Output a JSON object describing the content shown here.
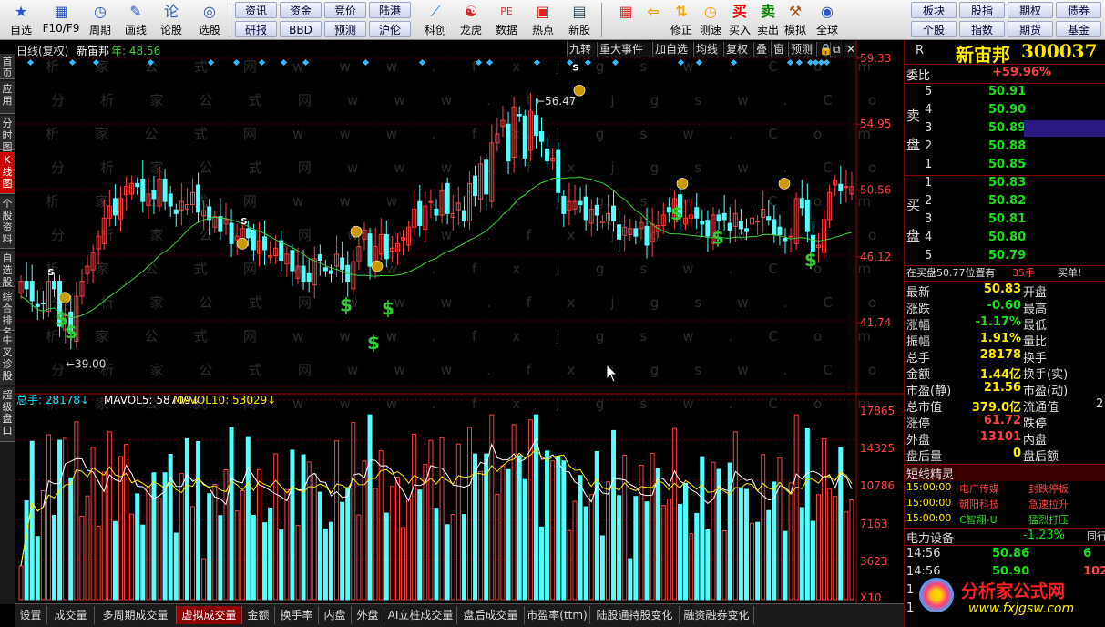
{
  "toolbar": {
    "items": [
      {
        "label": "自选",
        "icon": "star-icon"
      },
      {
        "label": "F10/F9",
        "icon": "grid-icon"
      },
      {
        "label": "周期",
        "icon": "clock-icon"
      },
      {
        "label": "画线",
        "icon": "pencil-icon"
      },
      {
        "label": "论股",
        "icon": "discuss-icon"
      },
      {
        "label": "选股",
        "icon": "chart-icon"
      }
    ],
    "buttons": [
      "资讯",
      "资金",
      "竞价",
      "陆港",
      "研报",
      "BBD",
      "预测",
      "沪伦"
    ],
    "items2": [
      {
        "label": "科创",
        "icon": "kechuang-icon"
      },
      {
        "label": "龙虎",
        "icon": "dragon-icon"
      },
      {
        "label": "数据",
        "icon": "pe-icon"
      },
      {
        "label": "热点",
        "icon": "hot-icon"
      },
      {
        "label": "新股",
        "icon": "doc-icon"
      }
    ],
    "items3": [
      {
        "label": "",
        "icon": "windows-icon"
      },
      {
        "label": "",
        "icon": "back-icon"
      },
      {
        "label": "修正",
        "icon": "fix-icon"
      },
      {
        "label": "测速",
        "icon": "speed-icon"
      },
      {
        "label": "买入",
        "icon": "buy-icon",
        "glyph": "买"
      },
      {
        "label": "卖出",
        "icon": "sell-icon",
        "glyph": "卖"
      },
      {
        "label": "模拟",
        "icon": "hammer-icon"
      },
      {
        "label": "全球",
        "icon": "globe-icon"
      }
    ],
    "buttons2": [
      "板块",
      "股指",
      "期权",
      "债券",
      "个股",
      "指数",
      "期货",
      "基金"
    ]
  },
  "lefttabs": [
    "首页",
    "应用",
    "分时图",
    "K线图",
    "个股资料",
    "自选股",
    "综合排名",
    "牛叉诊股",
    "超级盘口"
  ],
  "chart": {
    "title": "日线(复权)",
    "name": "新宙邦",
    "ma_label": "年: 48.56",
    "buttons": [
      "九转",
      "重大事件",
      "加自选",
      "均线",
      "复权",
      "叠",
      "窗",
      "预测",
      "🔒",
      "⧉",
      "✕"
    ],
    "price_ticks": [
      "59.33",
      "54.95",
      "50.56",
      "46.12",
      "41.74"
    ],
    "high_label": "56.47",
    "low_label": "39.00",
    "vol_legend": {
      "a": "总手: 28178↓",
      "b": "MAVOL5: 58709↓",
      "c": "MAVOL10: 53029↓"
    },
    "vol_ticks": [
      "17865",
      "14325",
      "10786",
      "7163",
      "3623",
      "X10"
    ],
    "watermark": "分析家公式网www.fxjgsw.Com"
  },
  "bottomtabs": [
    "设置",
    "成交量",
    "多周期成交量",
    "虚拟成交量",
    "金额",
    "换手率",
    "内盘",
    "外盘",
    "AI立桩成交量",
    "盘后成交量",
    "市盈率(ttm)",
    "陆股通持股变化",
    "融资融券变化"
  ],
  "bottom_active": 3,
  "panel": {
    "flag": "R",
    "name": "新宙邦",
    "code": "300037",
    "wb_label": "委比",
    "wb_value": "+59.96%",
    "sell": [
      [
        "5",
        "50.91"
      ],
      [
        "4",
        "50.90"
      ],
      [
        "3",
        "50.89"
      ],
      [
        "2",
        "50.88"
      ],
      [
        "1",
        "50.85"
      ]
    ],
    "buy": [
      [
        "1",
        "50.83"
      ],
      [
        "2",
        "50.82"
      ],
      [
        "3",
        "50.81"
      ],
      [
        "4",
        "50.80"
      ],
      [
        "5",
        "50.79"
      ]
    ],
    "sell_label": [
      "卖",
      "盘"
    ],
    "buy_label": [
      "买",
      "盘"
    ],
    "order_info": "在买盘50.77位置有",
    "order_count": "35手",
    "order_action": "买单!",
    "stats": [
      [
        "最新",
        "50.83",
        "开盘"
      ],
      [
        "涨跌",
        "-0.60",
        "最高"
      ],
      [
        "涨幅",
        "-1.17%",
        "最低"
      ],
      [
        "振幅",
        "1.91%",
        "量比"
      ],
      [
        "总手",
        "28178",
        "换手"
      ],
      [
        "金额",
        "1.44亿",
        "换手(实)"
      ],
      [
        "市盈(静)",
        "21.56",
        "市盈(动)"
      ],
      [
        "总市值",
        "379.0亿",
        "流通值"
      ],
      [
        "涨停",
        "61.72",
        "跌停"
      ],
      [
        "外盘",
        "13101",
        "内盘"
      ],
      [
        "盘后量",
        "0",
        "盘后额"
      ]
    ],
    "stats_extra": "2",
    "short_title": "短线精灵",
    "short": [
      [
        "15:00:00",
        "电广传媒",
        "封跌停板"
      ],
      [
        "15:00:00",
        "朝阳科技",
        "急速拉升"
      ],
      [
        "15:00:00",
        "C智翔-U",
        "猛烈打压"
      ]
    ],
    "sector": "电力设备",
    "sector_pct": "-1.23%",
    "sector_tag": "同行",
    "ticks": [
      [
        "14:56",
        "50.86",
        "6"
      ],
      [
        "14:56",
        "50.90",
        "102"
      ],
      [
        "1",
        "",
        ""
      ],
      [
        "1",
        "",
        ""
      ]
    ],
    "logo": "分析家公式网",
    "logo_url": "www.fxjgsw.com"
  },
  "colors": {
    "up": "#ff4040",
    "down": "#54ffff",
    "ma": "#3fcf3f",
    "grid": "#6b0000"
  },
  "chart_data": {
    "type": "candlestick",
    "high": 56.47,
    "low": 39.0,
    "ylim": [
      37.5,
      59.33
    ],
    "closes": [
      44.5,
      44.0,
      43.2,
      42.8,
      43.0,
      44.5,
      44.0,
      41.5,
      42.2,
      41.0,
      43.5,
      44.5,
      45.5,
      46.4,
      47.5,
      48.7,
      49.5,
      48.9,
      50.0,
      50.8,
      51.0,
      50.8,
      49.8,
      50.3,
      50.0,
      51.3,
      49.8,
      49.5,
      49.0,
      49.8,
      49.6,
      50.4,
      49.1,
      49.2,
      48.6,
      48.8,
      47.8,
      48.6,
      47.0,
      47.5,
      48.0,
      47.4,
      46.6,
      47.2,
      46.6,
      46.2,
      46.7,
      45.9,
      46.3,
      45.2,
      45.5,
      44.5,
      44.5,
      46.0,
      45.9,
      45.2,
      45.0,
      46.3,
      45.3,
      44.5,
      45.8,
      46.8,
      47.9,
      45.5,
      46.8,
      47.6,
      46.0,
      46.7,
      47.0,
      47.4,
      48.1,
      49.3,
      48.2,
      49.5,
      49.8,
      48.9,
      50.5,
      49.0,
      49.0,
      49.7,
      48.5,
      51.0,
      50.2,
      52.3,
      50.3,
      53.7,
      54.3,
      55.2,
      52.5,
      56.1,
      55.5,
      52.7,
      55.8,
      54.2,
      53.8,
      52.5,
      52.7,
      50.4,
      49.0,
      49.8,
      49.8,
      49.6,
      48.6,
      49.3,
      48.9,
      48.5,
      49.0,
      48.5,
      47.3,
      48.1,
      48.0,
      47.5,
      48.4,
      46.9,
      48.3,
      48.2,
      48.9,
      49.1,
      50.0,
      48.8,
      48.7,
      48.9,
      48.7,
      48.3,
      47.5,
      48.9,
      48.5,
      48.6,
      47.9,
      49.0,
      48.0,
      47.8,
      48.7,
      48.5,
      49.3,
      48.6,
      47.6,
      47.6,
      47.2,
      47.5,
      50.0,
      49.4,
      47.8,
      46.5,
      46.9,
      48.6,
      50.4,
      51.2,
      50.5,
      50.8,
      50.8
    ],
    "volume_max": 17865,
    "ma_label": "年"
  }
}
